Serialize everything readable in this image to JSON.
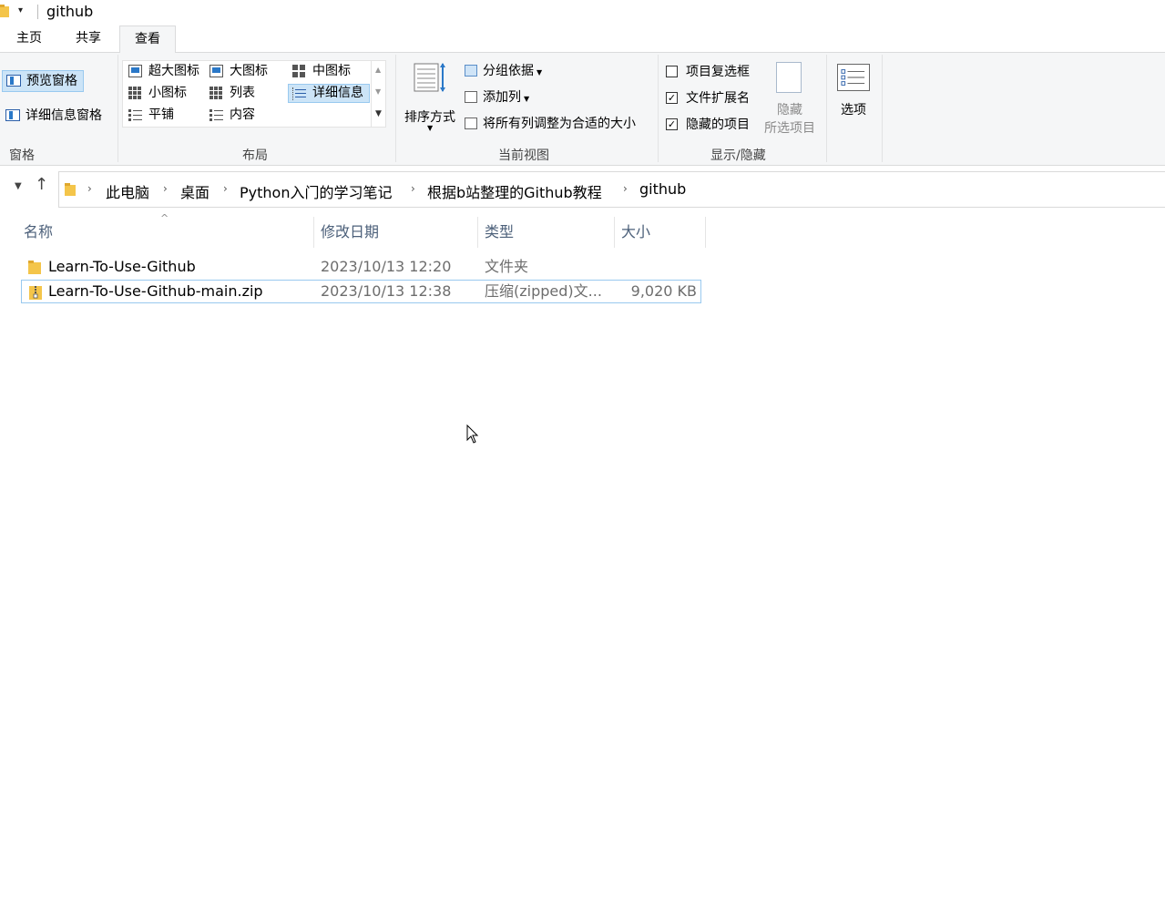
{
  "window": {
    "title": "github",
    "quick_access_dropdown": "▾"
  },
  "ribbon_tabs": [
    "主页",
    "共享",
    "查看"
  ],
  "ribbon": {
    "panes": {
      "preview_pane": "预览窗格",
      "details_pane": "详细信息窗格",
      "group_label": "窗格"
    },
    "layout": {
      "items": [
        "超大图标",
        "大图标",
        "中图标",
        "小图标",
        "列表",
        "详细信息",
        "平铺",
        "内容"
      ],
      "active": "详细信息",
      "group_label": "布局"
    },
    "current_view": {
      "sort_by": "排序方式",
      "group_by": "分组依据",
      "add_columns": "添加列",
      "size_columns": "将所有列调整为合适的大小",
      "group_label": "当前视图"
    },
    "show_hide": {
      "item_checkboxes": "项目复选框",
      "item_checkboxes_checked": false,
      "file_extensions": "文件扩展名",
      "file_extensions_checked": true,
      "hidden_items": "隐藏的项目",
      "hidden_items_checked": true,
      "hide_selected_line1": "隐藏",
      "hide_selected_line2": "所选项目",
      "group_label": "显示/隐藏",
      "checkmark": "✓"
    },
    "options": "选项"
  },
  "address_bar": {
    "breadcrumbs": [
      "此电脑",
      "桌面",
      "Python入门的学习笔记",
      "根据b站整理的Github教程",
      "github"
    ],
    "separator": "›"
  },
  "file_list": {
    "columns": [
      "名称",
      "修改日期",
      "类型",
      "大小"
    ],
    "sort_indicator": "^",
    "rows": [
      {
        "name": "Learn-To-Use-Github",
        "modified": "2023/10/13 12:20",
        "type": "文件夹",
        "size": "",
        "icon": "folder-icon"
      },
      {
        "name": "Learn-To-Use-Github-main.zip",
        "modified": "2023/10/13 12:38",
        "type": "压缩(zipped)文...",
        "size": "9,020 KB",
        "icon": "zip-folder-icon",
        "selected": true
      }
    ]
  },
  "colors": {
    "ribbon_bg": "#f5f6f7",
    "selection_bg": "#cce4f7",
    "selection_border": "#99c9ef",
    "header_text": "#4c607a",
    "folder_yellow": "#f4c54a"
  }
}
